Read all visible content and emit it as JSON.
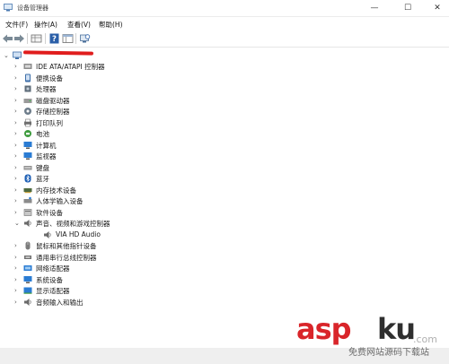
{
  "window": {
    "title": "设备管理器",
    "min_glyph": "—",
    "max_glyph": "☐",
    "close_glyph": "✕"
  },
  "menu": [
    "文件(F)",
    "操作(A)",
    "查看(V)",
    "帮助(H)"
  ],
  "toolbar": [
    "back-arrow-icon",
    "forward-arrow-icon",
    "computer-grid-icon",
    "help-icon",
    "properties-grid-icon",
    "scan-hardware-icon"
  ],
  "tree": {
    "root_expander": "⌄",
    "nodes": [
      {
        "label": "IDE ATA/ATAPI 控制器",
        "icon": "ide-controller-icon",
        "state": "collapsed"
      },
      {
        "label": "便携设备",
        "icon": "portable-device-icon",
        "state": "collapsed"
      },
      {
        "label": "处理器",
        "icon": "processor-icon",
        "state": "collapsed"
      },
      {
        "label": "磁盘驱动器",
        "icon": "disk-drive-icon",
        "state": "collapsed"
      },
      {
        "label": "存储控制器",
        "icon": "storage-controller-icon",
        "state": "collapsed"
      },
      {
        "label": "打印队列",
        "icon": "printer-icon",
        "state": "collapsed"
      },
      {
        "label": "电池",
        "icon": "battery-icon",
        "state": "collapsed"
      },
      {
        "label": "计算机",
        "icon": "computer-icon",
        "state": "collapsed"
      },
      {
        "label": "监视器",
        "icon": "monitor-icon",
        "state": "collapsed"
      },
      {
        "label": "键盘",
        "icon": "keyboard-icon",
        "state": "collapsed"
      },
      {
        "label": "蓝牙",
        "icon": "bluetooth-icon",
        "state": "collapsed"
      },
      {
        "label": "内存技术设备",
        "icon": "memory-device-icon",
        "state": "collapsed"
      },
      {
        "label": "人体学输入设备",
        "icon": "hid-icon",
        "state": "collapsed"
      },
      {
        "label": "软件设备",
        "icon": "software-device-icon",
        "state": "collapsed"
      },
      {
        "label": "声音、视频和游戏控制器",
        "icon": "speaker-icon",
        "state": "expanded"
      },
      {
        "label": "VIA HD Audio",
        "icon": "speaker-icon",
        "state": "leaf"
      },
      {
        "label": "鼠标和其他指针设备",
        "icon": "mouse-icon",
        "state": "collapsed"
      },
      {
        "label": "通用串行总线控制器",
        "icon": "usb-icon",
        "state": "collapsed"
      },
      {
        "label": "网络适配器",
        "icon": "network-adapter-icon",
        "state": "collapsed"
      },
      {
        "label": "系统设备",
        "icon": "system-device-icon",
        "state": "collapsed"
      },
      {
        "label": "显示适配器",
        "icon": "display-adapter-icon",
        "state": "collapsed"
      },
      {
        "label": "音频输入和输出",
        "icon": "audio-io-icon",
        "state": "collapsed"
      }
    ]
  },
  "colors": {
    "accent_blue": "#2b7cd3",
    "redaction": "#e01d1d",
    "watermark_red": "#d9252a"
  },
  "watermark": {
    "brand_a": "asp",
    "brand_b": "ku",
    "domain": ".com",
    "tagline": "免费网站源码下载站"
  }
}
